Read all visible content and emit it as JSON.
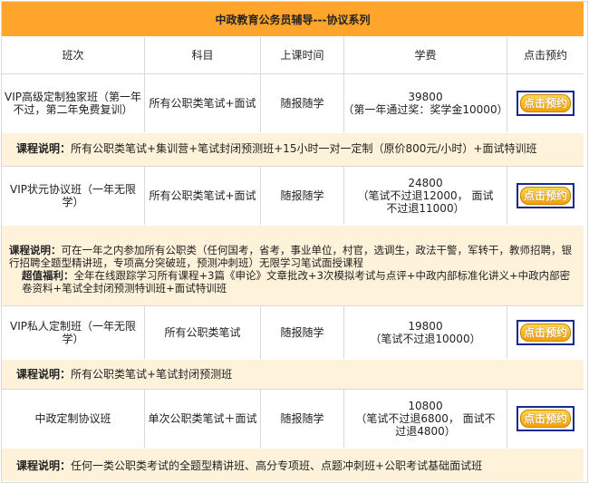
{
  "title": "中政教育公务员辅导---协议系列",
  "headers": [
    "班次",
    "科目",
    "上课时间",
    "学费",
    "点击预约"
  ],
  "book_label": "点击预约",
  "accent_color": "#ffa52c",
  "note_bg": "#fff2da",
  "rows": [
    {
      "name": "VIP高级定制独家班（第一年不过，第二年免费复训）",
      "subject": "所有公职类笔试+面试",
      "time": "随报随学",
      "fee_lines": [
        "39800",
        "（第一年通过奖：奖学金10000）"
      ],
      "note_label": "课程说明：",
      "note_text": "所有公职类笔试+集训营+笔试封闭预测班+15小时一对一定制（原价800元/小时）+面试特训班"
    },
    {
      "name": "VIP状元协议班（一年无限学）",
      "subject": "所有公职类笔试+面试",
      "time": "随报随学",
      "fee_lines": [
        "24800",
        "（笔试不过退12000， 面试不过退11000）"
      ],
      "note_label": "课程说明：",
      "note_text": "可在一年之内参加所有公职类（任何国考，省考，事业单位，村官，选调生，政法干警，军转干，教师招聘，银行招聘全题型精讲班，专项高分突破班，预测冲刺班）无限学习笔试面授课程",
      "note2_label": "超值福利：",
      "note2_text": "全年在线跟踪学习所有课程+3篇《申论》文章批改+3次模拟考试与点评+中政内部标准化讲义+中政内部密卷资料+笔试全封闭预测特训班+面试特训班"
    },
    {
      "name": "VIP私人定制班（一年无限学）",
      "subject": "所有公职类笔试",
      "time": "随报随学",
      "fee_lines": [
        "19800",
        "（笔试不过退10000）"
      ],
      "note_label": "课程说明：",
      "note_text": "所有公职类笔试+笔试封闭预测班"
    },
    {
      "name": "中政定制协议班",
      "subject": "单次公职类笔试＋面试",
      "time": "随报随学",
      "fee_lines": [
        "10800",
        "（笔试不过退6800， 面试不过退4800）"
      ],
      "note_label": "课程说明：",
      "note_text": "任何一类公职类考试的全题型精讲班、高分专项班、点题冲刺班+公职考试基础面试班"
    }
  ]
}
